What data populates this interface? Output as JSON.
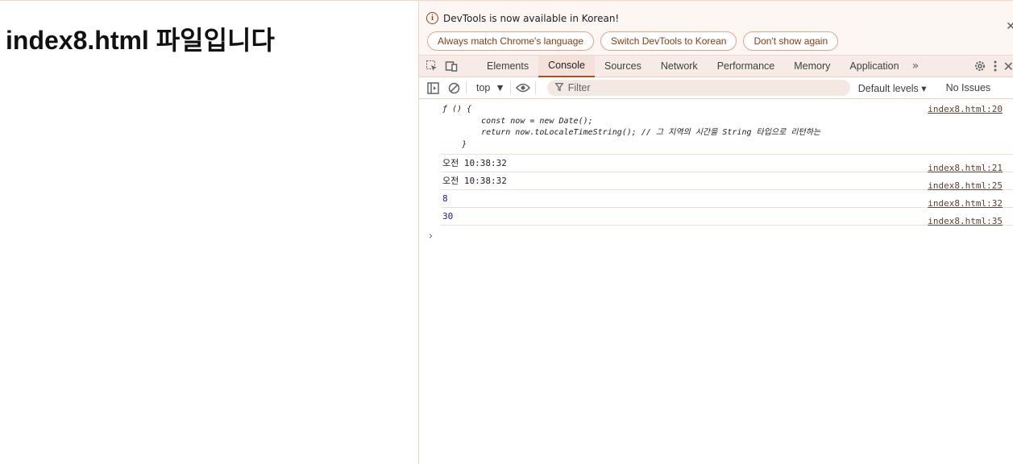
{
  "page": {
    "heading": "index8.html 파일입니다"
  },
  "infobar": {
    "message": "DevTools is now available in Korean!",
    "buttons": [
      "Always match Chrome's language",
      "Switch DevTools to Korean",
      "Don't show again"
    ]
  },
  "tabs": [
    "Elements",
    "Console",
    "Sources",
    "Network",
    "Performance",
    "Memory",
    "Application"
  ],
  "active_tab": "Console",
  "toolbar": {
    "context": "top",
    "filter_placeholder": "Filter",
    "levels": "Default levels",
    "issues": "No Issues"
  },
  "console": {
    "function_lines": [
      "ƒ () {",
      "        const now = new Date();",
      "        return now.toLocaleTimeString(); // 그 지역의 시간을 String 타입으로 리턴하는",
      "    }"
    ],
    "function_source": "index8.html:20",
    "messages": [
      {
        "text": "오전 10:38:32",
        "source": "index8.html:21",
        "numeric": false
      },
      {
        "text": "오전 10:38:32",
        "source": "index8.html:25",
        "numeric": false
      },
      {
        "text": "8",
        "source": "index8.html:32",
        "numeric": true
      },
      {
        "text": "30",
        "source": "index8.html:35",
        "numeric": true
      }
    ]
  },
  "colors": {
    "accent": "#b04d1f",
    "info_bg": "#fdf7f4",
    "tabbar_bg": "#f6ebe6"
  }
}
